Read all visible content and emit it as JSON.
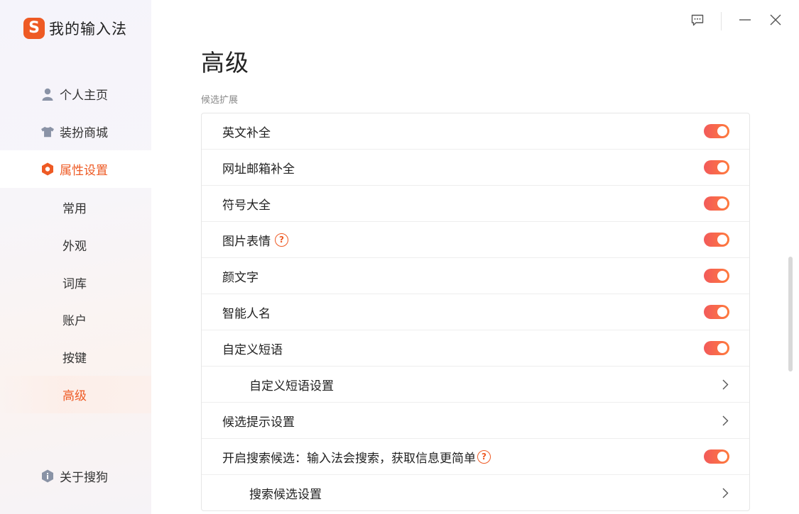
{
  "app": {
    "logo_letter": "S",
    "title": "我的输入法"
  },
  "nav": {
    "items": [
      {
        "label": "个人主页",
        "icon": "user-icon"
      },
      {
        "label": "装扮商城",
        "icon": "shirt-icon"
      },
      {
        "label": "属性设置",
        "icon": "hexagon-icon"
      }
    ],
    "sub_items": [
      "常用",
      "外观",
      "词库",
      "账户",
      "按键",
      "高级"
    ],
    "about": {
      "label": "关于搜狗",
      "icon": "info-icon"
    }
  },
  "active_nav": "属性设置",
  "active_sub": "高级",
  "window": {
    "icons": [
      "feedback-icon",
      "minimize-icon",
      "close-icon"
    ]
  },
  "page": {
    "title": "高级",
    "section_label": "候选扩展"
  },
  "rows": [
    {
      "label": "英文补全",
      "control": "toggle",
      "on": true
    },
    {
      "label": "网址邮箱补全",
      "control": "toggle",
      "on": true
    },
    {
      "label": "符号大全",
      "control": "toggle",
      "on": true
    },
    {
      "label": "图片表情",
      "control": "toggle",
      "on": true,
      "help": true
    },
    {
      "label": "颜文字",
      "control": "toggle",
      "on": true
    },
    {
      "label": "智能人名",
      "control": "toggle",
      "on": true
    },
    {
      "label": "自定义短语",
      "control": "toggle",
      "on": true
    },
    {
      "label": "自定义短语设置",
      "control": "chevron",
      "sub": true
    },
    {
      "label": "候选提示设置",
      "control": "chevron"
    },
    {
      "label": "开启搜索候选：输入法会搜索，获取信息更简单",
      "control": "toggle",
      "on": true,
      "help": true
    },
    {
      "label": "搜索候选设置",
      "control": "chevron",
      "sub": true
    }
  ],
  "colors": {
    "accent": "#ee5a24",
    "toggle_start": "#f25a5a",
    "toggle_end": "#ff7a3c"
  }
}
